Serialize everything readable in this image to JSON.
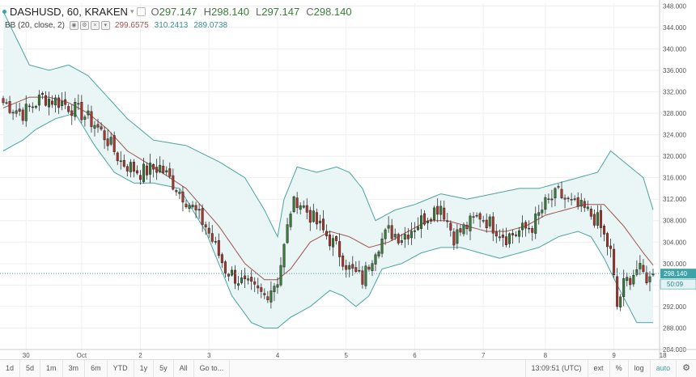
{
  "legend": {
    "symbol": "DASHUSD, 60, KRAKEN",
    "open_label": "O",
    "open": "297.147",
    "high_label": "H",
    "high": "298.140",
    "low_label": "L",
    "low": "297.147",
    "close_label": "C",
    "close": "298.140",
    "indicator": "BB (20, close, 2)",
    "bb_upper": "299.6575",
    "bb_basis": "310.2413",
    "bb_lower": "289.0738"
  },
  "price_tags": {
    "last": "298.140",
    "countdown": "50:09"
  },
  "toolbar": {
    "timeframes": [
      "1d",
      "5d",
      "1m",
      "3m",
      "6m",
      "YTD",
      "1y",
      "5y",
      "All"
    ],
    "goto_label": "Go to...",
    "time": "13:09:51 (UTC)",
    "ext_label": "ext",
    "percent_label": "%",
    "log_label": "log",
    "auto_label": "auto"
  },
  "colors": {
    "up": "#3a7d3a",
    "down": "#b3342a",
    "band": "#4aa3a3",
    "band_fill": "#e9f6f5",
    "basis": "#a0524e",
    "accent": "#3ea3a8"
  },
  "chart_data": {
    "type": "candlestick",
    "title": "DASHUSD, 60, KRAKEN",
    "y_ticks": [
      284,
      288,
      292,
      296,
      300,
      304,
      308,
      312,
      316,
      320,
      324,
      328,
      332,
      336,
      340,
      344,
      348
    ],
    "y_tick_labels": [
      "284.000",
      "288.000",
      "292.000",
      "296.000",
      "300.000",
      "304.000",
      "308.000",
      "312.000",
      "316.000",
      "320.000",
      "324.000",
      "328.000",
      "332.000",
      "336.000",
      "340.000",
      "344.000",
      "348.000"
    ],
    "x_ticks": [
      {
        "label": "30",
        "bar": 7
      },
      {
        "label": "Oct",
        "bar": 24
      },
      {
        "label": "2",
        "bar": 42
      },
      {
        "label": "3",
        "bar": 63
      },
      {
        "label": "4",
        "bar": 84
      },
      {
        "label": "5",
        "bar": 105
      },
      {
        "label": "6",
        "bar": 126
      },
      {
        "label": "7",
        "bar": 147
      },
      {
        "label": "8",
        "bar": 166
      },
      {
        "label": "9",
        "bar": 187
      },
      {
        "label": "18",
        "bar": 202
      }
    ],
    "ylim": [
      284,
      348.5
    ],
    "close_anchors": [
      [
        0,
        330
      ],
      [
        6,
        328
      ],
      [
        12,
        331
      ],
      [
        18,
        330
      ],
      [
        24,
        328
      ],
      [
        28,
        326
      ],
      [
        32,
        323
      ],
      [
        36,
        319
      ],
      [
        42,
        317
      ],
      [
        48,
        318
      ],
      [
        56,
        312
      ],
      [
        62,
        307
      ],
      [
        68,
        299
      ],
      [
        74,
        296
      ],
      [
        80,
        294
      ],
      [
        84,
        297
      ],
      [
        86,
        303
      ],
      [
        88,
        310
      ],
      [
        90,
        312
      ],
      [
        94,
        309
      ],
      [
        98,
        306
      ],
      [
        102,
        303
      ],
      [
        106,
        299
      ],
      [
        110,
        297
      ],
      [
        114,
        303
      ],
      [
        118,
        306
      ],
      [
        122,
        305
      ],
      [
        126,
        307
      ],
      [
        130,
        309
      ],
      [
        134,
        311
      ],
      [
        138,
        305
      ],
      [
        142,
        307
      ],
      [
        146,
        309
      ],
      [
        150,
        307
      ],
      [
        154,
        305
      ],
      [
        158,
        306
      ],
      [
        162,
        307
      ],
      [
        166,
        311
      ],
      [
        170,
        313
      ],
      [
        174,
        311
      ],
      [
        178,
        310
      ],
      [
        182,
        308
      ],
      [
        186,
        302
      ],
      [
        188,
        292
      ],
      [
        190,
        296
      ],
      [
        194,
        299
      ],
      [
        198,
        297
      ],
      [
        199,
        298.14
      ]
    ],
    "bollinger": {
      "upper_anchors": [
        [
          0,
          347
        ],
        [
          8,
          337
        ],
        [
          14,
          336
        ],
        [
          20,
          337
        ],
        [
          26,
          335
        ],
        [
          32,
          331
        ],
        [
          38,
          327
        ],
        [
          46,
          323
        ],
        [
          56,
          322
        ],
        [
          66,
          319
        ],
        [
          74,
          316
        ],
        [
          80,
          310
        ],
        [
          84,
          305
        ],
        [
          86,
          312
        ],
        [
          90,
          318
        ],
        [
          96,
          317
        ],
        [
          102,
          318
        ],
        [
          106,
          317
        ],
        [
          110,
          314
        ],
        [
          114,
          308
        ],
        [
          120,
          310
        ],
        [
          126,
          311
        ],
        [
          134,
          313
        ],
        [
          142,
          312
        ],
        [
          150,
          313
        ],
        [
          158,
          314
        ],
        [
          164,
          314
        ],
        [
          170,
          315
        ],
        [
          176,
          316
        ],
        [
          182,
          317
        ],
        [
          186,
          321
        ],
        [
          190,
          319
        ],
        [
          196,
          316
        ],
        [
          199,
          310
        ]
      ],
      "basis_anchors": [
        [
          0,
          329
        ],
        [
          8,
          331
        ],
        [
          14,
          331
        ],
        [
          20,
          330
        ],
        [
          26,
          328
        ],
        [
          32,
          325
        ],
        [
          38,
          321
        ],
        [
          46,
          318
        ],
        [
          56,
          314
        ],
        [
          66,
          307
        ],
        [
          74,
          300
        ],
        [
          80,
          297
        ],
        [
          84,
          297
        ],
        [
          88,
          299
        ],
        [
          94,
          304
        ],
        [
          100,
          306
        ],
        [
          106,
          305
        ],
        [
          112,
          303
        ],
        [
          118,
          304
        ],
        [
          124,
          306
        ],
        [
          130,
          308
        ],
        [
          136,
          308
        ],
        [
          142,
          307
        ],
        [
          148,
          306
        ],
        [
          154,
          306
        ],
        [
          160,
          307
        ],
        [
          166,
          309
        ],
        [
          172,
          310
        ],
        [
          178,
          311
        ],
        [
          184,
          311
        ],
        [
          190,
          307
        ],
        [
          196,
          302
        ],
        [
          199,
          299.7
        ]
      ],
      "lower_anchors": [
        [
          0,
          321
        ],
        [
          6,
          323
        ],
        [
          10,
          325
        ],
        [
          16,
          327
        ],
        [
          22,
          328
        ],
        [
          28,
          322
        ],
        [
          34,
          317
        ],
        [
          40,
          315
        ],
        [
          46,
          315
        ],
        [
          54,
          314
        ],
        [
          62,
          306
        ],
        [
          70,
          294
        ],
        [
          76,
          289
        ],
        [
          80,
          288
        ],
        [
          84,
          288
        ],
        [
          88,
          290
        ],
        [
          94,
          292
        ],
        [
          100,
          295
        ],
        [
          104,
          294
        ],
        [
          108,
          292
        ],
        [
          112,
          294
        ],
        [
          116,
          299
        ],
        [
          122,
          300
        ],
        [
          128,
          302
        ],
        [
          134,
          303
        ],
        [
          140,
          303
        ],
        [
          146,
          302
        ],
        [
          152,
          301
        ],
        [
          158,
          302
        ],
        [
          164,
          303
        ],
        [
          170,
          305
        ],
        [
          176,
          306
        ],
        [
          180,
          305
        ],
        [
          184,
          301
        ],
        [
          188,
          296
        ],
        [
          194,
          289
        ],
        [
          199,
          289
        ]
      ]
    },
    "bar_count": 200,
    "last_price": 298.14
  }
}
